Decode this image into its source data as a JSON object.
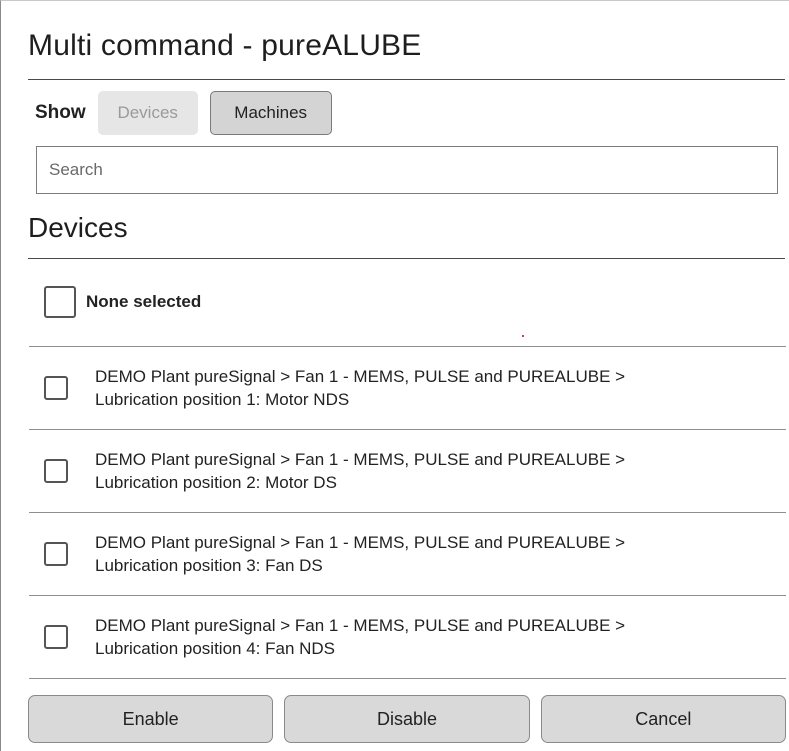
{
  "dialog": {
    "title": "Multi command - pureALUBE"
  },
  "show": {
    "label": "Show",
    "options": [
      {
        "label": "Devices",
        "state": "inactive"
      },
      {
        "label": "Machines",
        "state": "active"
      }
    ]
  },
  "search": {
    "placeholder": "Search",
    "value": ""
  },
  "devices": {
    "heading": "Devices",
    "select_all_label": "None selected",
    "items": [
      {
        "line1": "DEMO Plant pureSignal > Fan 1 - MEMS, PULSE and PUREALUBE >",
        "line2": "Lubrication position 1: Motor NDS",
        "checked": false
      },
      {
        "line1": "DEMO Plant pureSignal > Fan 1 - MEMS, PULSE and PUREALUBE >",
        "line2": "Lubrication position 2: Motor DS",
        "checked": false
      },
      {
        "line1": "DEMO Plant pureSignal > Fan 1 - MEMS, PULSE and PUREALUBE >",
        "line2": "Lubrication position 3: Fan DS",
        "checked": false
      },
      {
        "line1": "DEMO Plant pureSignal > Fan 1 - MEMS, PULSE and PUREALUBE >",
        "line2": "Lubrication position 4: Fan NDS",
        "checked": false
      }
    ]
  },
  "footer": {
    "enable_label": "Enable",
    "disable_label": "Disable",
    "cancel_label": "Cancel"
  }
}
